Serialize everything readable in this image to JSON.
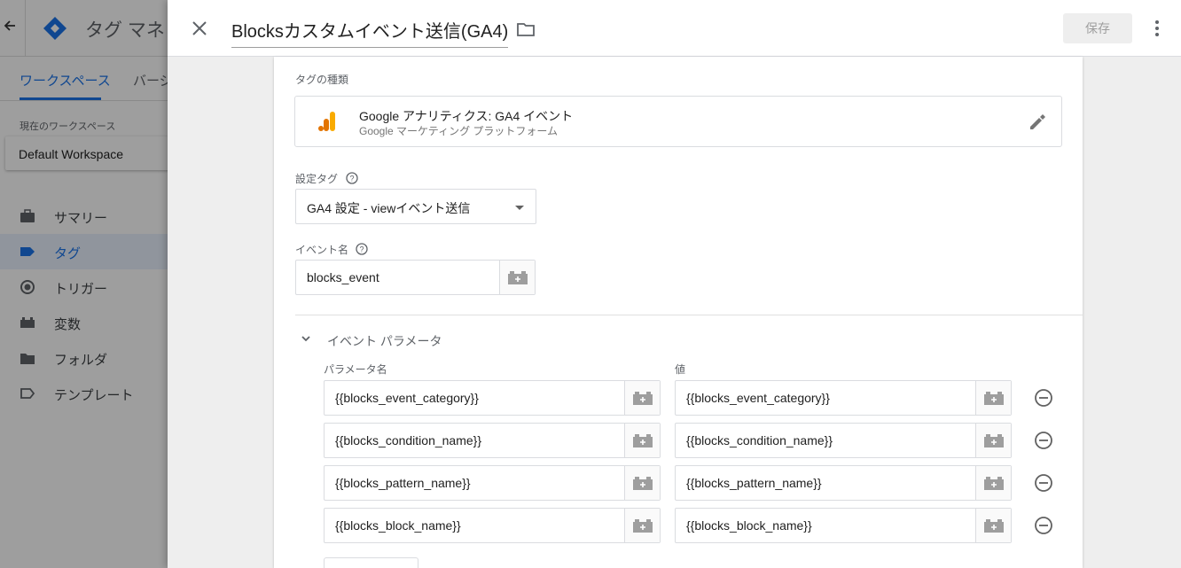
{
  "background": {
    "app_title": "タグ マネ",
    "tabs": [
      "ワークスペース",
      "バージ"
    ],
    "workspace_label": "現在のワークスペース",
    "workspace_name": "Default Workspace",
    "nav": [
      {
        "label": "サマリー",
        "icon": "briefcase-icon"
      },
      {
        "label": "タグ",
        "icon": "tag-icon",
        "active": true
      },
      {
        "label": "トリガー",
        "icon": "trigger-icon"
      },
      {
        "label": "変数",
        "icon": "variable-icon"
      },
      {
        "label": "フォルダ",
        "icon": "folder-icon"
      },
      {
        "label": "テンプレート",
        "icon": "template-icon"
      }
    ]
  },
  "header": {
    "tag_name": "Blocksカスタムイベント送信(GA4)",
    "save_label": "保存"
  },
  "tag_type": {
    "label": "タグの種類",
    "name": "Google アナリティクス: GA4 イベント",
    "vendor": "Google マーケティング プラットフォーム"
  },
  "config_tag": {
    "label": "設定タグ",
    "value": "GA4 設定 - viewイベント送信"
  },
  "event_name": {
    "label": "イベント名",
    "value": "blocks_event"
  },
  "event_params": {
    "title": "イベント パラメータ",
    "name_header": "パラメータ名",
    "value_header": "値",
    "rows": [
      {
        "name": "{{blocks_event_category}}",
        "value": "{{blocks_event_category}}"
      },
      {
        "name": "{{blocks_condition_name}}",
        "value": "{{blocks_condition_name}}"
      },
      {
        "name": "{{blocks_pattern_name}}",
        "value": "{{blocks_pattern_name}}"
      },
      {
        "name": "{{blocks_block_name}}",
        "value": "{{blocks_block_name}}"
      }
    ]
  },
  "colors": {
    "accent": "#1a73e8",
    "ga_orange": "#f9ab00",
    "ga_dark_orange": "#e37400"
  }
}
